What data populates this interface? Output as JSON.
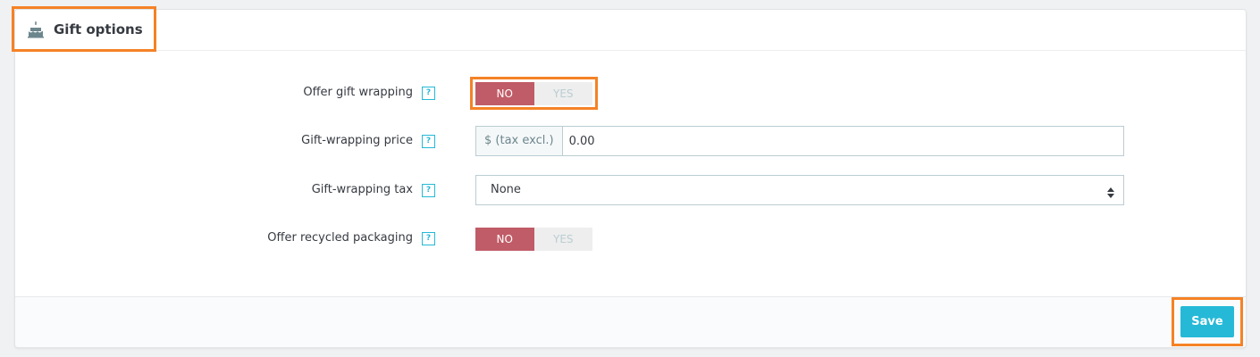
{
  "panel": {
    "title": "Gift options",
    "title_icon": "birthday-cake-icon"
  },
  "form": {
    "offer_gift_wrapping": {
      "label": "Offer gift wrapping",
      "help_icon": "help-icon",
      "help_glyph": "?",
      "options": [
        "NO",
        "YES"
      ],
      "selected": "NO"
    },
    "gift_wrapping_price": {
      "label": "Gift-wrapping price",
      "help_icon": "help-icon",
      "help_glyph": "?",
      "addon": "$ (tax excl.)",
      "value": "0.00"
    },
    "gift_wrapping_tax": {
      "label": "Gift-wrapping tax",
      "help_icon": "help-icon",
      "help_glyph": "?",
      "selected_value": "None"
    },
    "offer_recycled_packaging": {
      "label": "Offer recycled packaging",
      "help_icon": "help-icon",
      "help_glyph": "?",
      "options": [
        "NO",
        "YES"
      ],
      "selected": "NO"
    }
  },
  "footer": {
    "save_label": "Save"
  },
  "colors": {
    "accent": "#25b9d7",
    "switch_active": "#c05c67",
    "highlight": "#f58226"
  }
}
